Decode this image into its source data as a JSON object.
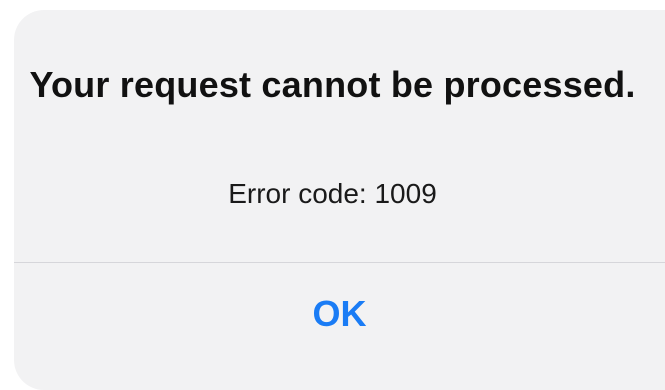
{
  "alert": {
    "title": "Your request cannot be processed.",
    "message": "Error code: 1009",
    "ok_label": "OK"
  },
  "colors": {
    "background": "#f2f2f3",
    "accent": "#1a7cf5",
    "divider": "#d6d6da"
  }
}
